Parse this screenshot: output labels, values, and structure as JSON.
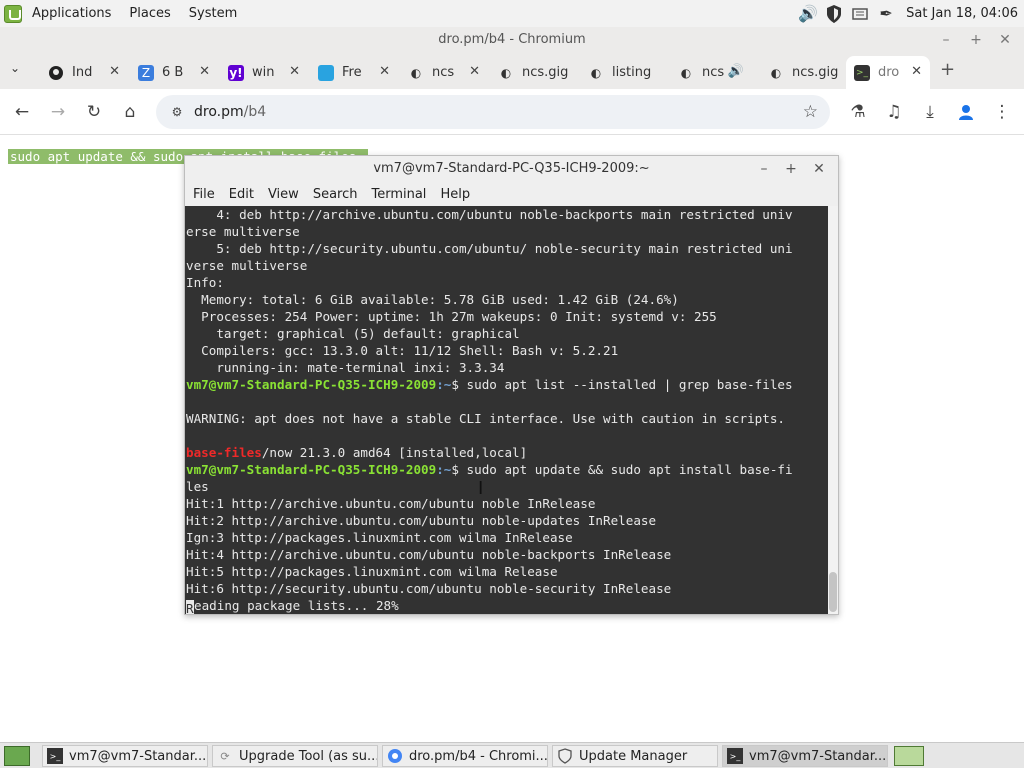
{
  "top_panel": {
    "menus": [
      "Applications",
      "Places",
      "System"
    ],
    "clock": "Sat Jan 18, 04:06"
  },
  "browser": {
    "window_title": "dro.pm/b4 - Chromium",
    "tabs": [
      {
        "label": "Ind",
        "icon": "github-icon"
      },
      {
        "label": "6 B",
        "icon": "zap-icon"
      },
      {
        "label": "win",
        "icon": "yahoo-icon"
      },
      {
        "label": "Fre",
        "icon": "freelancer-icon"
      },
      {
        "label": "ncs",
        "icon": "globe-icon"
      },
      {
        "label": "ncs.gig",
        "icon": "globe-icon"
      },
      {
        "label": "listing",
        "icon": "globe-icon"
      },
      {
        "label": "ncs",
        "icon": "globe-icon"
      },
      {
        "label": "ncs.gig",
        "icon": "globe-icon"
      },
      {
        "label": "dro",
        "icon": "terminal-icon"
      }
    ],
    "url_host": "dro.pm",
    "url_path": "/b4"
  },
  "page": {
    "selected_text": "sudo apt update && sudo apt install base-files"
  },
  "terminal": {
    "title": "vm7@vm7-Standard-PC-Q35-ICH9-2009:~",
    "menu": [
      "File",
      "Edit",
      "View",
      "Search",
      "Terminal",
      "Help"
    ],
    "prompt_user": "vm7@vm7-Standard-PC-Q35-ICH9-2009",
    "prompt_path": ":~",
    "lines": [
      "    4: deb http://archive.ubuntu.com/ubuntu noble-backports main restricted univ",
      "erse multiverse",
      "    5: deb http://security.ubuntu.com/ubuntu/ noble-security main restricted uni",
      "verse multiverse",
      "Info:",
      "  Memory: total: 6 GiB available: 5.78 GiB used: 1.42 GiB (24.6%)",
      "  Processes: 254 Power: uptime: 1h 27m wakeups: 0 Init: systemd v: 255",
      "    target: graphical (5) default: graphical",
      "  Compilers: gcc: 13.3.0 alt: 11/12 Shell: Bash v: 5.2.21",
      "    running-in: mate-terminal inxi: 3.3.34"
    ],
    "cmd1": "$ sudo apt list --installed | grep base-files",
    "warning": "WARNING: apt does not have a stable CLI interface. Use with caution in scripts.",
    "result_name": "base-files",
    "result_rest": "/now 21.3.0 amd64 [installed,local]",
    "cmd2": "$ sudo apt update && sudo apt install base-fi",
    "cmd2_wrap": "les",
    "hits": [
      "Hit:1 http://archive.ubuntu.com/ubuntu noble InRelease",
      "Hit:2 http://archive.ubuntu.com/ubuntu noble-updates InRelease",
      "Ign:3 http://packages.linuxmint.com wilma InRelease",
      "Hit:4 http://archive.ubuntu.com/ubuntu noble-backports InRelease",
      "Hit:5 http://packages.linuxmint.com wilma Release",
      "Hit:6 http://security.ubuntu.com/ubuntu noble-security InRelease"
    ],
    "last_line_first": "R",
    "last_line_rest": "eading package lists... 28%"
  },
  "taskbar": {
    "items": [
      {
        "label": "vm7@vm7-Standar...",
        "icon": "terminal-icon"
      },
      {
        "label": "Upgrade Tool (as su...",
        "icon": "upgrade-icon"
      },
      {
        "label": "dro.pm/b4 - Chromi...",
        "icon": "chromium-icon"
      },
      {
        "label": "Update Manager",
        "icon": "shield-icon"
      },
      {
        "label": "vm7@vm7-Standar...",
        "icon": "terminal-icon"
      }
    ]
  }
}
